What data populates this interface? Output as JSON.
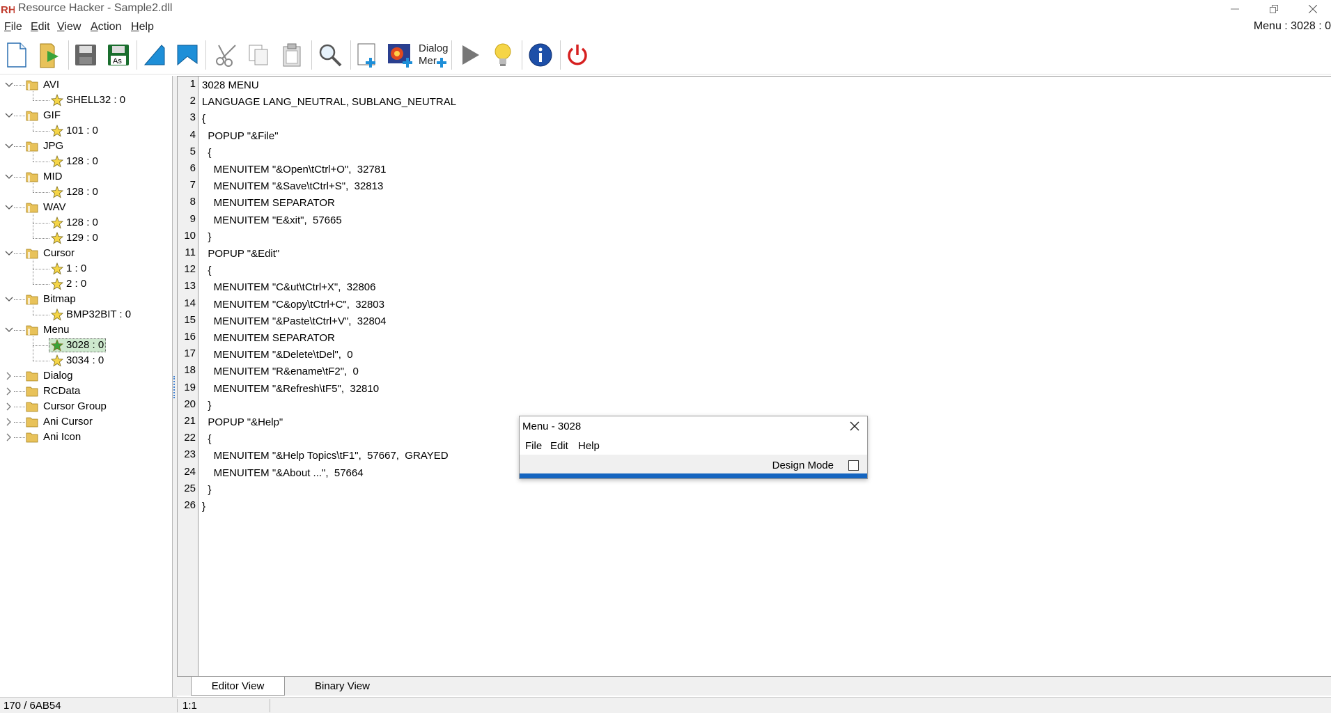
{
  "window": {
    "title": "Resource Hacker - Sample2.dll",
    "logo_text": "RH",
    "status_right": "Menu : 3028 : 0"
  },
  "menubar": [
    {
      "label": "File",
      "key": "F"
    },
    {
      "label": "Edit",
      "key": "E"
    },
    {
      "label": "View",
      "key": "V"
    },
    {
      "label": "Action",
      "key": "A"
    },
    {
      "label": "Help",
      "key": "H"
    }
  ],
  "toolbar": {
    "dialog_menu_label_1": "Dialog",
    "dialog_menu_label_2": "Mer"
  },
  "tree": {
    "groups": [
      {
        "label": "AVI",
        "children": [
          "SHELL32 : 0"
        ]
      },
      {
        "label": "GIF",
        "children": [
          "101 : 0"
        ]
      },
      {
        "label": "JPG",
        "children": [
          "128 : 0"
        ]
      },
      {
        "label": "MID",
        "children": [
          "128 : 0"
        ]
      },
      {
        "label": "WAV",
        "children": [
          "128 : 0",
          "129 : 0"
        ]
      },
      {
        "label": "Cursor",
        "children": [
          "1 : 0",
          "2 : 0"
        ]
      },
      {
        "label": "Bitmap",
        "children": [
          "BMP32BIT : 0"
        ]
      },
      {
        "label": "Menu",
        "children": [
          "3028 : 0",
          "3034 : 0"
        ]
      },
      {
        "label": "Dialog",
        "children": []
      },
      {
        "label": "RCData",
        "children": []
      },
      {
        "label": "Cursor Group",
        "children": []
      },
      {
        "label": "Ani Cursor",
        "children": []
      },
      {
        "label": "Ani Icon",
        "children": []
      }
    ],
    "selected": "3028 : 0"
  },
  "editor": {
    "lines": [
      "3028 MENU",
      "LANGUAGE LANG_NEUTRAL, SUBLANG_NEUTRAL",
      "{",
      "  POPUP \"&File\"",
      "  {",
      "    MENUITEM \"&Open\\tCtrl+O\",  32781",
      "    MENUITEM \"&Save\\tCtrl+S\",  32813",
      "    MENUITEM SEPARATOR",
      "    MENUITEM \"E&xit\",  57665",
      "  }",
      "  POPUP \"&Edit\"",
      "  {",
      "    MENUITEM \"C&ut\\tCtrl+X\",  32806",
      "    MENUITEM \"C&opy\\tCtrl+C\",  32803",
      "    MENUITEM \"&Paste\\tCtrl+V\",  32804",
      "    MENUITEM SEPARATOR",
      "    MENUITEM \"&Delete\\tDel\",  0",
      "    MENUITEM \"R&ename\\tF2\",  0",
      "    MENUITEM \"&Refresh\\tF5\",  32810",
      "  }",
      "  POPUP \"&Help\"",
      "  {",
      "    MENUITEM \"&Help Topics\\tF1\",  57667,  GRAYED",
      "    MENUITEM \"&About ...\",  57664",
      "  }",
      "}"
    ]
  },
  "tabs": {
    "editor_view": "Editor View",
    "binary_view": "Binary View"
  },
  "statusbar": {
    "left": "170 / 6AB54",
    "position": "1:1"
  },
  "preview": {
    "title": "Menu -  3028",
    "menu": [
      "File",
      "Edit",
      "Help"
    ],
    "design_mode_label": "Design Mode",
    "design_mode_checked": false
  },
  "colors": {
    "selection": "#cde8cd",
    "accent_blue": "#1565c0",
    "folder": "#e8c25a",
    "star": "#f5d547"
  }
}
